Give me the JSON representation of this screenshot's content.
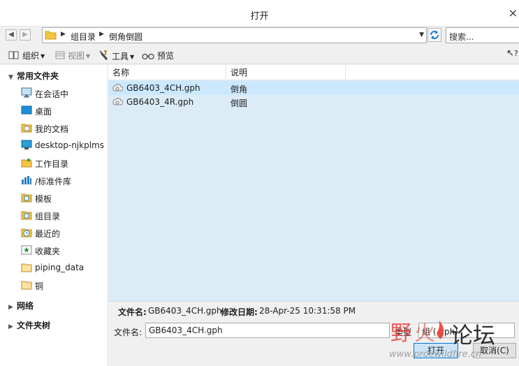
{
  "window": {
    "title": "打开",
    "close_glyph": "×"
  },
  "nav": {
    "back_glyph": "◀",
    "forward_glyph": "▶",
    "breadcrumb": [
      "组目录",
      "倒角倒圆"
    ],
    "search_placeholder": "搜索..."
  },
  "toolbar": {
    "organize": "组织",
    "view": "视图",
    "tools": "工具",
    "preview": "预览",
    "help_glyph": "?"
  },
  "sidebar": {
    "favorites_header": "常用文件夹",
    "items": [
      {
        "label": "在会话中",
        "icon": "monitor-icon"
      },
      {
        "label": "桌面",
        "icon": "desktop-icon"
      },
      {
        "label": "我的文档",
        "icon": "documents-icon"
      },
      {
        "label": "desktop-njkplms",
        "icon": "computer-icon"
      },
      {
        "label": "工作目录",
        "icon": "working-dir-icon"
      },
      {
        "label": "/标准件库",
        "icon": "library-icon"
      },
      {
        "label": "模板",
        "icon": "template-icon"
      },
      {
        "label": "组目录",
        "icon": "group-dir-icon"
      },
      {
        "label": "最近的",
        "icon": "recent-icon"
      },
      {
        "label": "收藏夹",
        "icon": "favorites-icon"
      },
      {
        "label": "piping_data",
        "icon": "folder-icon"
      },
      {
        "label": "铜",
        "icon": "folder-icon"
      }
    ],
    "network_header": "网络",
    "folder_tree_header": "文件夹树"
  },
  "file_list": {
    "columns": [
      "名称",
      "说明"
    ],
    "rows": [
      {
        "name": "GB6403_4CH.gph",
        "desc": "倒角",
        "selected": true
      },
      {
        "name": "GB6403_4R.gph",
        "desc": "倒圆",
        "selected": false
      }
    ]
  },
  "details": {
    "filename_label": "文件名:",
    "filename_value": "GB6403_4CH.gph",
    "modified_label": "修改日期:",
    "modified_value": "28-Apr-25 10:31:58 PM"
  },
  "bottom": {
    "filename_label": "文件名:",
    "filename_value": "GB6403_4CH.gph",
    "type_label": "类型",
    "type_value": "组 (.gph)",
    "open_button": "打开",
    "cancel_button": "取消(C)"
  },
  "watermark": {
    "text": "野火论坛",
    "url": "www.proewildfire.cn"
  },
  "colors": {
    "file_pane_bg": "#dcecf6",
    "selected_row": "#cce8ff",
    "accent": "#0078d7",
    "folder_yellow": "#f4c542",
    "watermark_red": "#e8423c"
  }
}
